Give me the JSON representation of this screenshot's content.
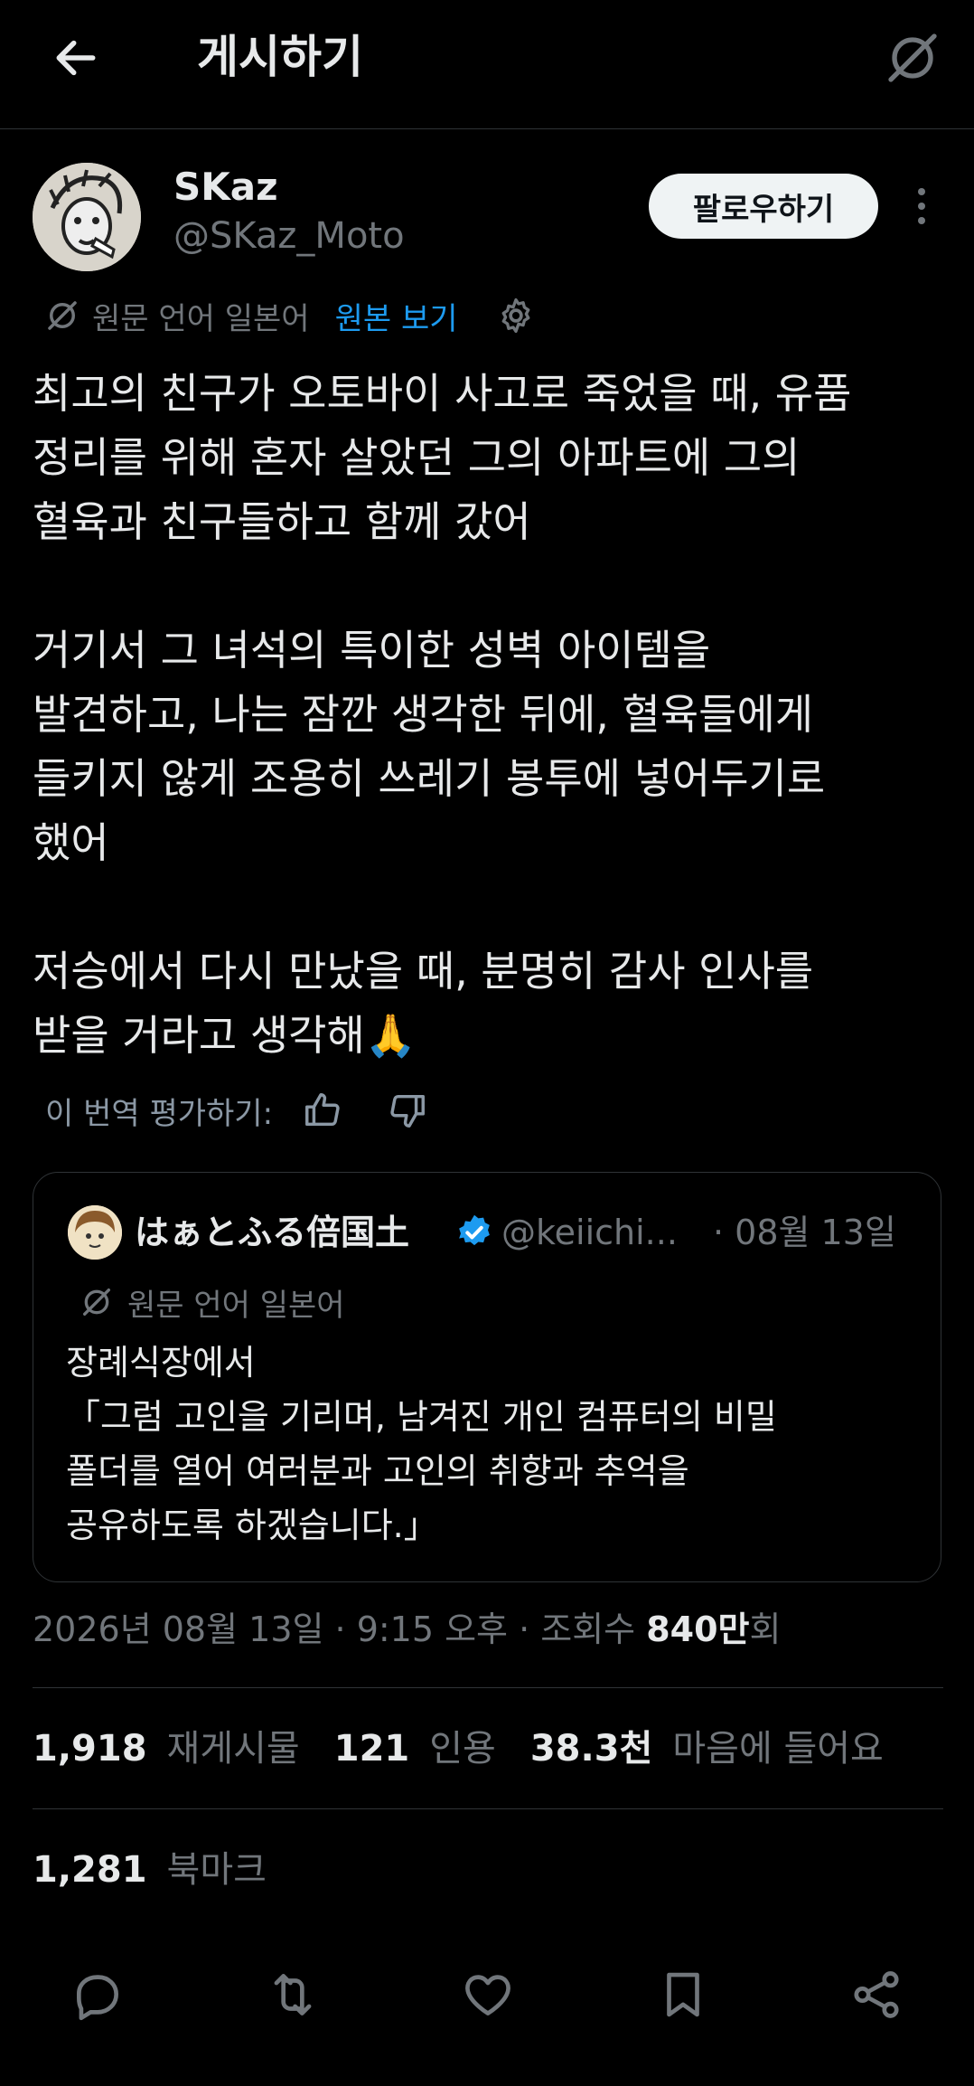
{
  "header": {
    "title": "게시하기",
    "back_icon": "arrow-left-icon",
    "grok_icon": "grok-icon"
  },
  "author": {
    "name": "SKaz",
    "handle": "@SKaz_Moto",
    "follow_label": "팔로우하기",
    "more_icon": "more-vertical-icon"
  },
  "translation": {
    "source_label": "원문 언어 일본어",
    "show_original_label": "원본 보기",
    "settings_icon": "gear-icon"
  },
  "tweet": {
    "text": "최고의 친구가 오토바이 사고로 죽었을 때, 유품\n정리를 위해 혼자 살았던 그의 아파트에 그의\n혈육과 친구들하고 함께 갔어\n\n거기서 그 녀석의 특이한 성벽 아이템을\n발견하고, 나는 잠깐 생각한 뒤에, 혈육들에게\n들키지 않게 조용히 쓰레기 봉투에 넣어두기로\n했어\n\n저승에서 다시 만났을 때, 분명히 감사 인사를\n받을 거라고 생각해🙏"
  },
  "rate": {
    "label": "이 번역 평가하기:",
    "up_icon": "thumbs-up-icon",
    "down_icon": "thumbs-down-icon"
  },
  "quote": {
    "name": "はぁとふる倍国土",
    "handle": "@keiichi...",
    "date": "· 08월 13일",
    "translate_label": "원문 언어 일본어",
    "text": "장례식장에서\n「그럼 고인을 기리며, 남겨진 개인 컴퓨터의 비밀\n폴더를 열어 여러분과 고인의 취향과 추억을\n공유하도록 하겠습니다.」",
    "verified_color": "#1d9bf0"
  },
  "meta": {
    "date_time": "2026년 08월 13일 · 9:15 오후 · 조회수 ",
    "views": "840만",
    "views_suffix": "회"
  },
  "stats": {
    "reposts_count": "1,918",
    "reposts_label": "재게시물",
    "quotes_count": "121",
    "quotes_label": "인용",
    "likes_count": "38.3천",
    "likes_label": "마음에 들어요",
    "bookmarks_count": "1,281",
    "bookmarks_label": "북마크"
  },
  "actions": [
    "reply-icon",
    "repost-icon",
    "like-icon",
    "bookmark-icon",
    "share-icon"
  ],
  "colors": {
    "background": "#000000",
    "text": "#e7e9ea",
    "secondary": "#71767b",
    "link": "#1d9bf0",
    "divider": "#2f3336"
  }
}
